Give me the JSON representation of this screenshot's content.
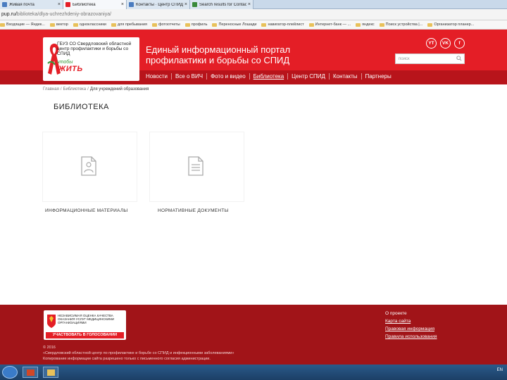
{
  "browser": {
    "tabs": [
      {
        "label": "Живая почта",
        "active": false
      },
      {
        "label": "Библиотека",
        "active": true
      },
      {
        "label": "Контакты · Центр СПИД",
        "active": false
      },
      {
        "label": "Search results for Contact",
        "active": false
      }
    ],
    "url_host": "pup.ru/",
    "url_path": "biblioteka/dlya-uchrezhdeniy-obrazovaniya/",
    "bookmarks": [
      "Входящие — Яндек...",
      "вектор",
      "одноклассники",
      "для пребывания",
      "фотоотчеты",
      "профиль",
      "Переносные Лошади",
      "навигатор-плейлист",
      "Интернет-банк — ...",
      "яндекс",
      "Поиск устройства |...",
      "Организатор планер..."
    ]
  },
  "header": {
    "logo_org": "ГБУЗ СО Свердловский областной центр профилактики и борьбы со СПИД",
    "logo_chtoby": "чтобы",
    "logo_zhit": "ЖИТЬ",
    "portal_title": "Единый информационный портал профилактики и борьбы со СПИД",
    "search_placeholder": "поиск",
    "socials": [
      "YT",
      "VK",
      "f"
    ],
    "nav": [
      {
        "label": "Новости",
        "active": false
      },
      {
        "label": "Все о ВИЧ",
        "active": false
      },
      {
        "label": "Фото и видео",
        "active": false
      },
      {
        "label": "Библиотека",
        "active": true
      },
      {
        "label": "Центр СПИД",
        "active": false
      },
      {
        "label": "Контакты",
        "active": false
      },
      {
        "label": "Партнеры",
        "active": false
      }
    ]
  },
  "breadcrumb": {
    "home": "Главная",
    "section": "Библиотека",
    "current": "Для учреждений образования"
  },
  "main": {
    "title": "БИБЛИОТЕКА",
    "cards": [
      {
        "label": "ИНФОРМАЦИОННЫЕ МАТЕРИАЛЫ",
        "icon": "person-document-icon"
      },
      {
        "label": "НОРМАТИВНЫЕ ДОКУМЕНТЫ",
        "icon": "document-icon"
      }
    ]
  },
  "footer": {
    "badge_text": "НЕЗАВИСИМАЯ ОЦЕНКА КАЧЕСТВА ОКАЗАНИЯ УСЛУГ МЕДИЦИНСКИМИ ОРГАНИЗАЦИЯМИ",
    "badge_button": "УЧАСТВОВАТЬ В ГОЛОСОВАНИИ",
    "links": [
      {
        "label": "О проекте",
        "underline": false
      },
      {
        "label": "Карта сайта",
        "underline": true
      },
      {
        "label": "Правовая информация",
        "underline": true
      },
      {
        "label": "Правила использования",
        "underline": true
      }
    ],
    "copyright_line1": "© 2016",
    "copyright_line2": "«Свердловский областной центр по профилактике и борьбе со СПИД и инфекционными заболеваниями»",
    "copyright_line3": "Копирование информации сайта разрешено только с письменного согласия администрации."
  },
  "taskbar": {
    "lang": "EN"
  },
  "colors": {
    "brand_red": "#e41e26",
    "dark_red": "#b8141b",
    "footer_red": "#a11418"
  }
}
